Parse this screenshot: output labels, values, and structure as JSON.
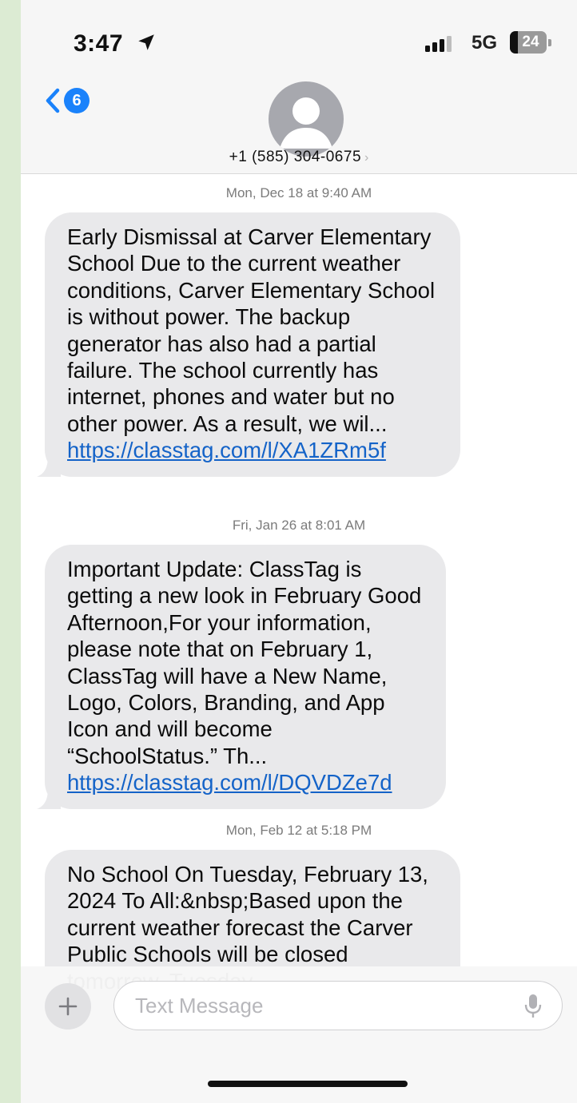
{
  "status_bar": {
    "time": "3:47",
    "network": "5G",
    "battery_level": "24",
    "location_icon": "location-arrow-icon",
    "signal_icon": "signal-bars-icon"
  },
  "header": {
    "back_badge_count": "6",
    "contact_number": "+1 (585) 304-0675",
    "contact_chevron": "›",
    "avatar_icon": "person-silhouette-icon"
  },
  "messages": [
    {
      "timestamp": "Mon, Dec 18 at 9:40 AM",
      "text": "Early Dismissal at Carver Elementary School Due to the current weather conditions, Carver Elementary School is without power. The backup generator has also had a partial failure. The school currently has internet, phones and water but no other power. As a result, we wil...",
      "link": "https://classtag.com/l/XA1ZRm5f"
    },
    {
      "timestamp": "Fri, Jan 26 at 8:01 AM",
      "text": "Important Update: ClassTag is getting a new look in February Good Afternoon,For your information, please note that on February 1, ClassTag will have a New Name, Logo, Colors, Branding, and App Icon and will become “SchoolStatus.” Th...",
      "link": "https://classtag.com/l/DQVDZe7d"
    },
    {
      "timestamp": "Mon, Feb 12 at 5:18 PM",
      "text": "No School On Tuesday, February 13, 2024 To All:&nbsp;Based upon the current weather forecast the Carver Public Schools will be closed tomorrow, Tuesday,",
      "link": ""
    }
  ],
  "composer": {
    "placeholder": "Text Message",
    "plus_icon": "plus-icon",
    "mic_icon": "microphone-icon"
  },
  "colors": {
    "background": "#dcebd3",
    "accent_blue": "#1a82fb",
    "bubble_gray": "#e9e9eb",
    "link_blue": "#1463c8"
  }
}
